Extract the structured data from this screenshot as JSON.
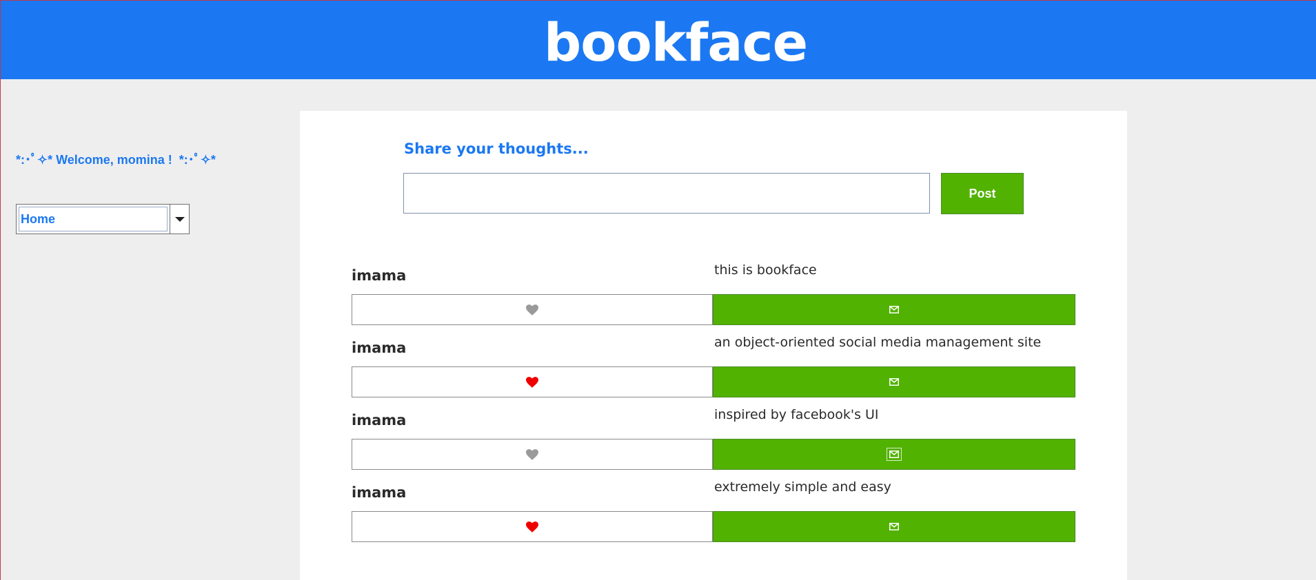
{
  "header": {
    "brand": "bookface",
    "color": "#1b78f2"
  },
  "sidebar": {
    "welcome": "*:･ﾟ✧* Welcome, momina !  *:･ﾟ✧*",
    "nav_select": {
      "selected": "Home"
    }
  },
  "composer": {
    "label": "Share your thoughts...",
    "input_value": "",
    "input_placeholder": "",
    "post_label": "Post"
  },
  "colors": {
    "accent": "#1b78f2",
    "button_green": "#52b202",
    "heart_liked": "#ee0000",
    "heart_unliked": "#9a9a9a"
  },
  "feed": [
    {
      "author": "imama",
      "text": "this is bookface",
      "liked": false,
      "like_icon": "heart-icon",
      "message_icon": "mail-icon"
    },
    {
      "author": "imama",
      "text": "an object-oriented social media management site",
      "liked": true,
      "like_icon": "heart-icon",
      "message_icon": "mail-icon"
    },
    {
      "author": "imama",
      "text": "inspired by facebook's UI",
      "liked": false,
      "like_icon": "heart-icon",
      "message_icon": "mail-icon"
    },
    {
      "author": "imama",
      "text": "extremely simple and easy",
      "liked": true,
      "like_icon": "heart-icon",
      "message_icon": "mail-icon"
    }
  ]
}
